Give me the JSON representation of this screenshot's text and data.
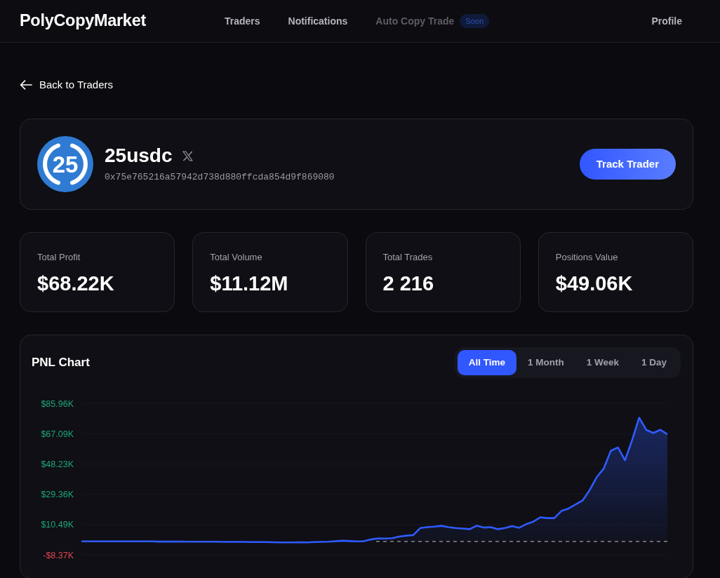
{
  "navbar": {
    "brand": "PolyCopyMarket",
    "links": [
      {
        "label": "Traders",
        "disabled": false
      },
      {
        "label": "Notifications",
        "disabled": false
      },
      {
        "label": "Auto Copy Trade",
        "disabled": true,
        "badge": "Soon"
      }
    ],
    "profile": "Profile"
  },
  "back_link": {
    "label": "Back to Traders"
  },
  "trader": {
    "avatar_text": "25",
    "name": "25usdc",
    "address": "0x75e765216a57942d738d880ffcda854d9f869080",
    "track_button": "Track Trader"
  },
  "stats": [
    {
      "label": "Total Profit",
      "value": "$68.22K"
    },
    {
      "label": "Total Volume",
      "value": "$11.12M"
    },
    {
      "label": "Total Trades",
      "value": "2 216"
    },
    {
      "label": "Positions Value",
      "value": "$49.06K"
    }
  ],
  "pnl_chart": {
    "title": "PNL Chart",
    "ranges": [
      {
        "label": "All Time",
        "selected": true
      },
      {
        "label": "1 Month",
        "selected": false
      },
      {
        "label": "1 Week",
        "selected": false
      },
      {
        "label": "1 Day",
        "selected": false
      }
    ],
    "chart_data": {
      "type": "area",
      "grid": true,
      "ylim": [
        -8.37,
        85.96
      ],
      "yticks": [
        {
          "value": 85.96,
          "label": "$85.96K"
        },
        {
          "value": 67.09,
          "label": "$67.09K"
        },
        {
          "value": 48.23,
          "label": "$48.23K"
        },
        {
          "value": 29.36,
          "label": "$29.36K"
        },
        {
          "value": 10.49,
          "label": "$10.49K"
        },
        {
          "value": -8.37,
          "label": "-$8.37K"
        }
      ],
      "ref_lines": [
        {
          "axis": "y",
          "value": 0
        }
      ],
      "series": [
        {
          "color": "#2f5bff",
          "values": [
            0,
            0,
            0,
            0,
            0,
            0,
            0,
            0,
            0,
            0,
            0,
            -0.1,
            -0.1,
            -0.1,
            -0.1,
            -0.2,
            -0.2,
            -0.2,
            -0.2,
            -0.2,
            -0.3,
            -0.3,
            -0.3,
            -0.3,
            -0.4,
            -0.4,
            -0.4,
            -0.5,
            -0.6,
            -0.6,
            -0.6,
            -0.5,
            -0.6,
            -0.4,
            -0.3,
            -0.2,
            0.1,
            0.4,
            0.2,
            0.0,
            0.1,
            1.2,
            1.9,
            1.8,
            2.0,
            3.0,
            3.6,
            3.9,
            8.3,
            8.9,
            9.2,
            9.7,
            8.9,
            8.3,
            8.0,
            7.6,
            9.8,
            8.6,
            8.9,
            7.6,
            8.3,
            9.6,
            8.5,
            10.7,
            12.3,
            15.0,
            14.5,
            14.5,
            19.0,
            20.5,
            23.0,
            25.5,
            32.0,
            40.0,
            45.5,
            56.5,
            58.5,
            50.5,
            63.0,
            77.0,
            69.5,
            67.5,
            69.5,
            66.7
          ]
        }
      ]
    }
  }
}
